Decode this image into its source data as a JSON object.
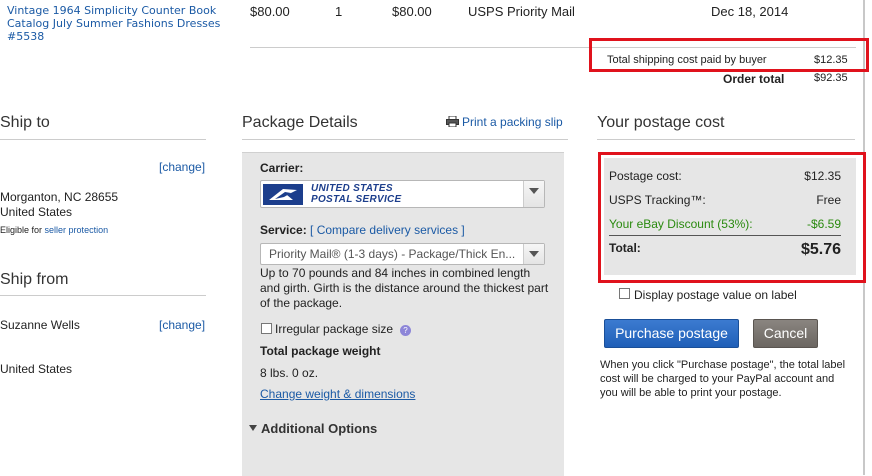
{
  "item": {
    "title": "Vintage 1964 Simplicity Counter Book Catalog July Summer Fashions Dresses #5538",
    "price": "$80.00",
    "qty": "1",
    "subtotal": "$80.00",
    "shipping_service": "USPS Priority Mail",
    "date": "Dec 18, 2014"
  },
  "totals": {
    "shipping_label": "Total shipping cost paid by buyer",
    "shipping_value": "$12.35",
    "order_label": "Order total",
    "order_value": "$92.35"
  },
  "ship_to": {
    "heading": "Ship to",
    "change": "[change]",
    "city": "Morganton, NC 28655",
    "country": "United States",
    "eligible_prefix": "Eligible for",
    "seller_protection": "seller protection"
  },
  "ship_from": {
    "heading": "Ship from",
    "name": "Suzanne Wells",
    "change": "[change]",
    "country": "United States"
  },
  "package": {
    "heading": "Package Details",
    "print_slip": "Print a packing slip",
    "carrier_label": "Carrier:",
    "carrier_line1": "UNITED STATES",
    "carrier_line2": "POSTAL SERVICE",
    "service_label": "Service:",
    "compare_link": "[ Compare delivery services ]",
    "service_value": "Priority Mail® (1-3 days) - Package/Thick En...",
    "service_desc": "Up to 70 pounds and 84 inches in combined length and girth. Girth is the distance around the thickest part of the package.",
    "irregular_label": "Irregular package size",
    "weight_heading": "Total package weight",
    "weight_value": "8 lbs. 0 oz.",
    "change_weight": "Change weight & dimensions",
    "additional": "Additional Options"
  },
  "postage": {
    "heading": "Your postage cost",
    "rows": [
      {
        "label": "Postage cost:",
        "value": "$12.35"
      },
      {
        "label": "USPS Tracking™:",
        "value": "Free"
      },
      {
        "label": "Your eBay Discount (53%):",
        "value": "-$6.59"
      }
    ],
    "total_label": "Total:",
    "total_value": "$5.76",
    "display_label": "Display postage value on label",
    "purchase": "Purchase postage",
    "cancel": "Cancel",
    "note": "When you click \"Purchase postage\", the total label cost will be charged to your PayPal account and you will be able to print your postage.",
    "discount_color": "#2a8a0f",
    "highlight_color": "#e0121c"
  }
}
